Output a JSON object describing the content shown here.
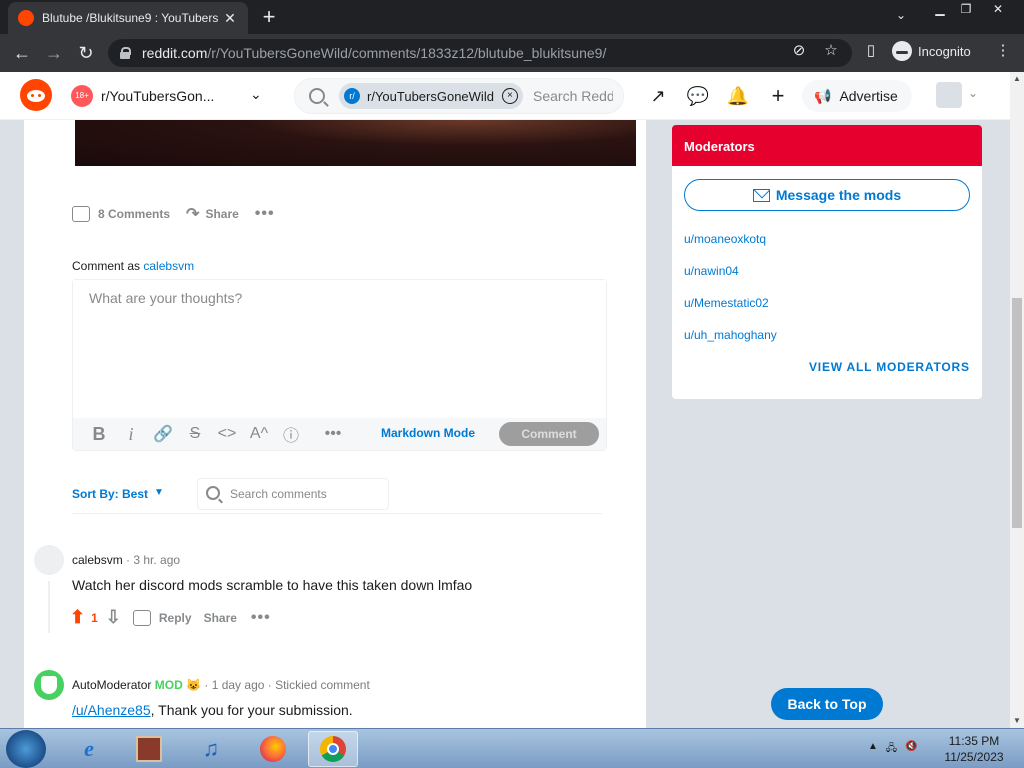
{
  "browser": {
    "tab_title": "Blutube /Blukitsune9 : YouTubers",
    "tab_close": "✕",
    "new_tab": "+",
    "url_host": "reddit.com",
    "url_path": "/r/YouTubersGoneWild/comments/1833z12/blutube_blukitsune9/",
    "incognito_label": "Incognito"
  },
  "reddit_header": {
    "nsfw_badge": "18+",
    "subreddit": "r/YouTubersGon...",
    "search_chip": "r/YouTubersGoneWild",
    "search_placeholder": "Search Reddit",
    "advertise": "Advertise"
  },
  "post": {
    "comments_label": "8 Comments",
    "share_label": "Share",
    "more": "•••"
  },
  "composer": {
    "comment_as_prefix": "Comment as",
    "username": "calebsvm",
    "placeholder": "What are your thoughts?",
    "markdown_mode": "Markdown Mode",
    "submit": "Comment"
  },
  "sort": {
    "label": "Sort By: Best",
    "search_placeholder": "Search comments"
  },
  "comments": [
    {
      "author": "calebsvm",
      "time": "3 hr. ago",
      "body": "Watch her discord mods scramble to have this taken down lmfao",
      "votes": "1",
      "reply": "Reply",
      "share": "Share"
    },
    {
      "author": "AutoModerator",
      "mod_badge": "MOD",
      "time": "1 day ago",
      "stickied": "Stickied comment",
      "body_link": "/u/Ahenze85",
      "body_rest": ", Thank you for your submission."
    }
  ],
  "sidebar": {
    "moderators_title": "Moderators",
    "message_mods": "Message the mods",
    "mods": [
      "u/moaneoxkotq",
      "u/nawin04",
      "u/Memestatic02",
      "u/uh_mahoghany"
    ],
    "view_all": "VIEW ALL MODERATORS"
  },
  "back_to_top": "Back to Top",
  "taskbar": {
    "time": "11:35 PM",
    "date": "11/25/2023"
  },
  "colors": {
    "reddit_orange": "#ff4500",
    "link_blue": "#0079d3",
    "mods_header_red": "#e6002e",
    "mod_green": "#46d160"
  }
}
